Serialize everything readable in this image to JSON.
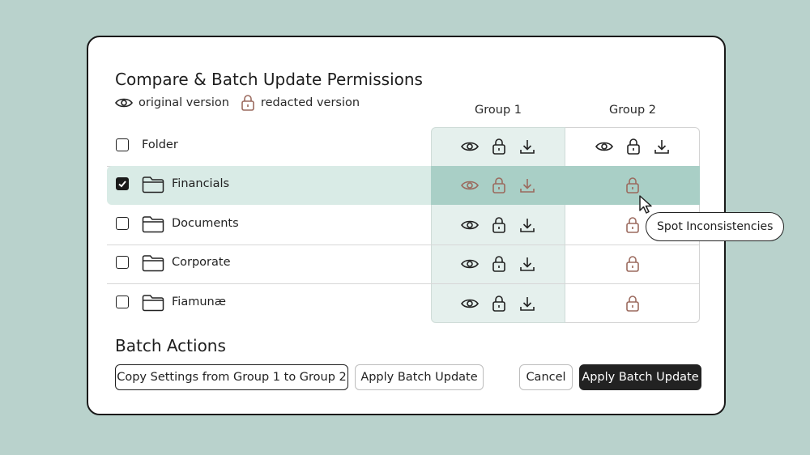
{
  "dialog": {
    "title": "Compare & Batch Update Permissions",
    "legend": [
      {
        "icon": "eye-icon",
        "label": "original version"
      },
      {
        "icon": "lock-icon",
        "label": "redacted version"
      }
    ],
    "groups": [
      "Group 1",
      "Group 2"
    ]
  },
  "rows": [
    {
      "label": "Folder",
      "checked": false,
      "has_folder_icon": false,
      "selected": false
    },
    {
      "label": "Financials",
      "checked": true,
      "has_folder_icon": true,
      "selected": true
    },
    {
      "label": "Documents",
      "checked": false,
      "has_folder_icon": true,
      "selected": false
    },
    {
      "label": "Corporate",
      "checked": false,
      "has_folder_icon": true,
      "selected": false
    },
    {
      "label": "Fiamunæ",
      "checked": false,
      "has_folder_icon": true,
      "selected": false
    }
  ],
  "group_cells": {
    "group1_icons": [
      "eye-icon",
      "lock-icon",
      "download-icon"
    ],
    "group2_row0_icons": [
      "eye-icon",
      "lock-icon",
      "download-icon"
    ],
    "group2_other_icons": [
      "lock-icon"
    ]
  },
  "tooltip": {
    "text": "Spot Inconsistencies"
  },
  "batch": {
    "title": "Batch Actions",
    "copy_button": "Copy Settings from Group 1 to Group 2",
    "apply_secondary_button": "Apply Batch Update",
    "cancel_button": "Cancel",
    "apply_primary_button": "Apply Batch Update"
  },
  "colors": {
    "background": "#b9d2cc",
    "selected_row": "#d9ebe6",
    "selected_cell": "#a9cfc6",
    "redacted_lock": "#9b6a5e",
    "primary_button": "#222222"
  }
}
